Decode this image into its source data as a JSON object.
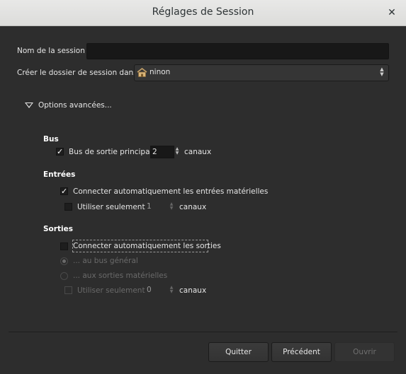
{
  "window": {
    "title": "Réglages de Session",
    "close_glyph": "✕"
  },
  "session": {
    "name_label": "Nom de la session :",
    "name_value": "",
    "folder_label": "Créer le dossier de session dans :",
    "folder_value": "ninon",
    "folder_icon": "home-folder-icon"
  },
  "advanced": {
    "label": "Options avancées..."
  },
  "bus": {
    "heading": "Bus",
    "master_label": "Bus de sortie principal à",
    "master_value": "2",
    "channels_label": "canaux"
  },
  "inputs": {
    "heading": "Entrées",
    "auto_connect_label": "Connecter automatiquement les entrées matérielles",
    "auto_connect_checked": true,
    "limit_label": "Utiliser seulement",
    "limit_value": "1",
    "channels_label": "canaux"
  },
  "outputs": {
    "heading": "Sorties",
    "auto_connect_label": "Connecter automatiquement les sorties",
    "auto_connect_checked": false,
    "to_master_label": "... au bus général",
    "to_physical_label": "... aux sorties matérielles",
    "limit_label": "Utiliser seulement",
    "limit_value": "0",
    "channels_label": "canaux"
  },
  "buttons": {
    "quit": "Quitter",
    "previous": "Précédent",
    "open": "Ouvrir"
  }
}
